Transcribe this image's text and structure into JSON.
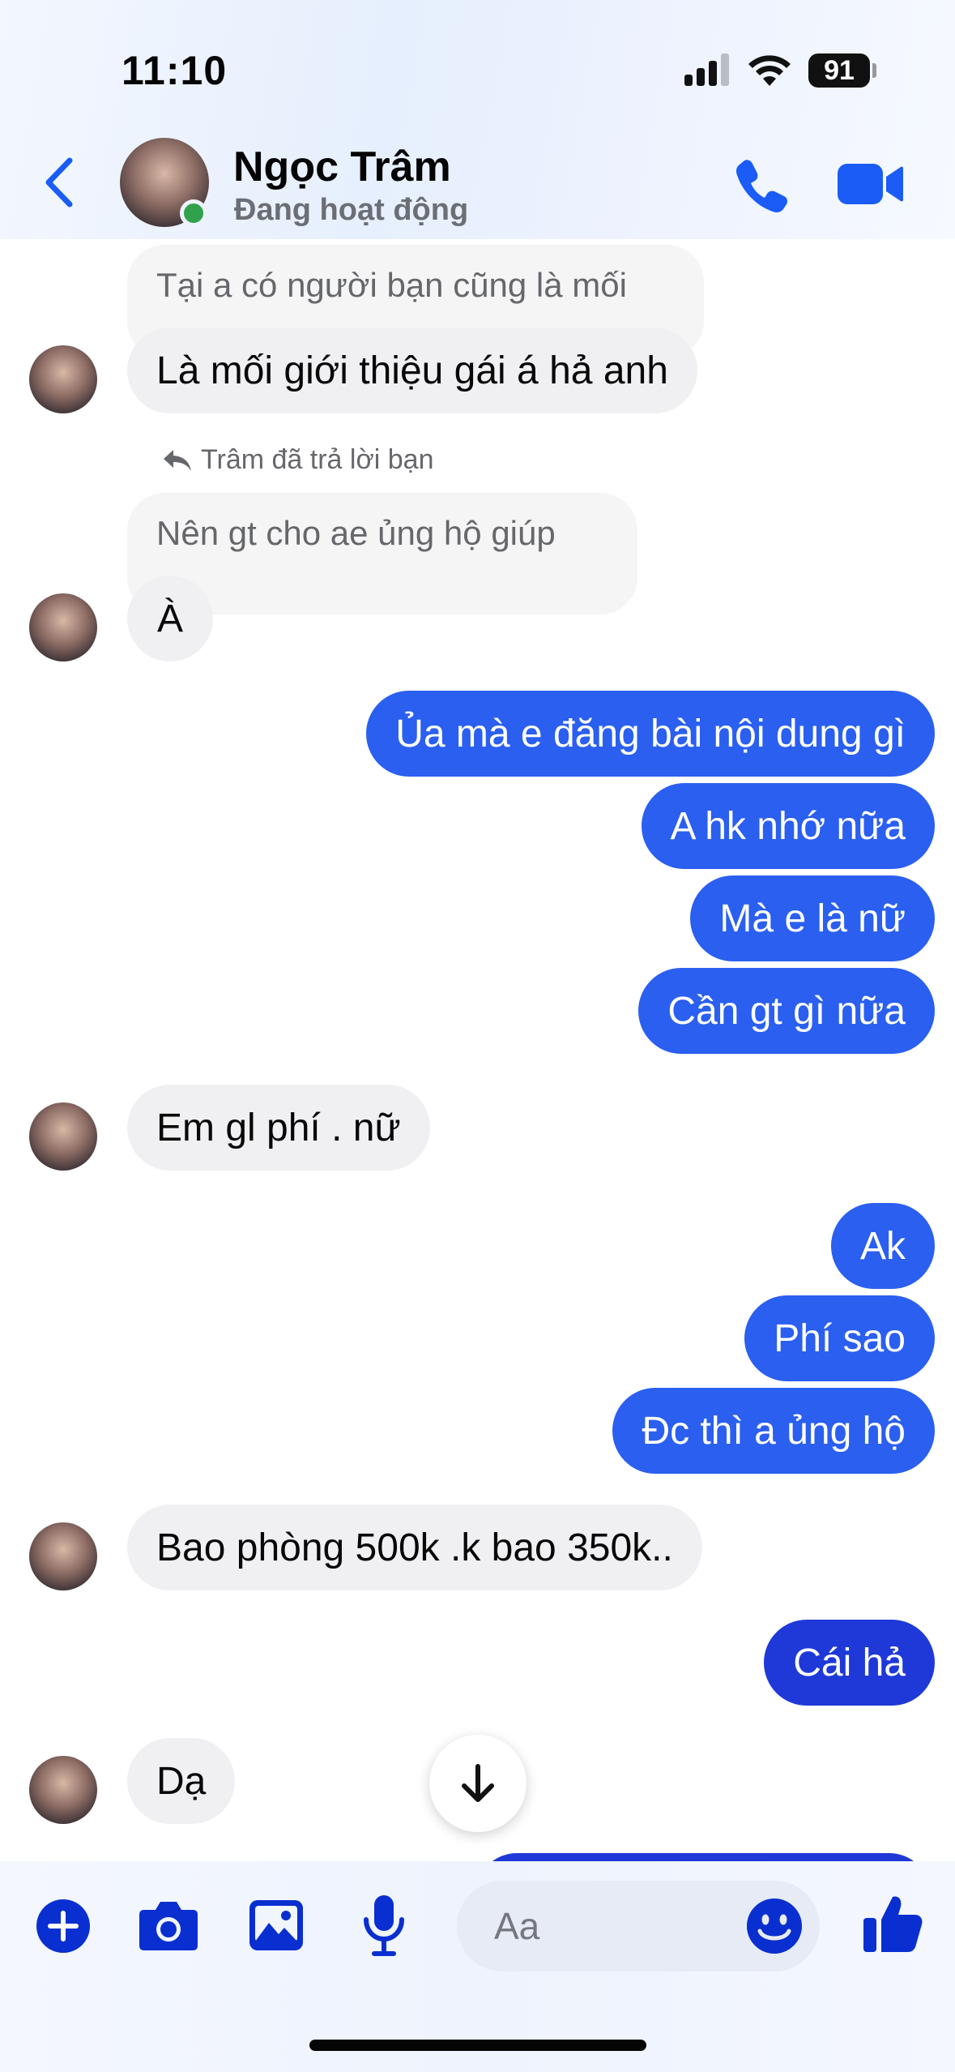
{
  "status_bar": {
    "time": "11:10",
    "battery": "91"
  },
  "header": {
    "name": "Ngọc Trâm",
    "status": "Đang hoạt động"
  },
  "conversation": {
    "quoted_1": "Tại a có người bạn cũng là mối",
    "msg_1": "Là mối giới thiệu gái á hả anh",
    "reply_label": "Trâm đã trả lời bạn",
    "quoted_2": "Nên gt cho ae ủng hộ giúp",
    "msg_2": "À",
    "out_1": "Ủa mà e đăng bài nội dung gì",
    "out_2": "A hk nhớ nữa",
    "out_3": "Mà e là nữ",
    "out_4": "Cần gt gì nữa",
    "msg_3": "Em gl phí . nữ",
    "out_5": "Ak",
    "out_6": "Phí sao",
    "out_7": "Đc thì a ủng hộ",
    "msg_4": "Bao phòng 500k .k bao 350k..",
    "out_8": "Cái hả",
    "msg_5": "Dạ"
  },
  "composer": {
    "placeholder": "Aa"
  },
  "colors": {
    "accent": "#2a5ff0",
    "accent_dark": "#1e39d8",
    "icon": "#0a2fd0",
    "online": "#31a24c"
  },
  "icons": [
    "back-chevron-icon",
    "phone-icon",
    "video-camera-icon",
    "scroll-down-arrow-icon",
    "plus-icon",
    "camera-icon",
    "image-icon",
    "microphone-icon",
    "emoji-icon",
    "thumbs-up-icon"
  ]
}
